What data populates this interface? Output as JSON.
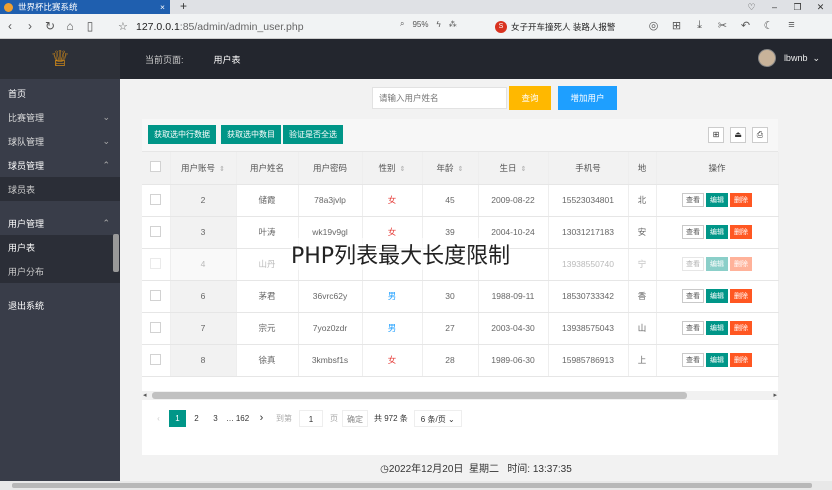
{
  "browser": {
    "tab_title": "世界杯比赛系统",
    "tab_close": "×",
    "new_tab": "+",
    "url_host": "127.0.0.1",
    "url_path": ":85/admin/admin_user.php",
    "zoom": "95%",
    "search_text": "女子开车撞死人 装路人报警",
    "window_controls": [
      "♡",
      "–",
      "❐",
      "✕"
    ]
  },
  "sidebar": {
    "logo_icon": "soccer-trophy-icon",
    "items": [
      {
        "label": "首页",
        "chev": ""
      },
      {
        "label": "比赛管理",
        "chev": "⌄"
      },
      {
        "label": "球队管理",
        "chev": "⌄"
      },
      {
        "label": "球员管理",
        "chev": "⌃"
      },
      {
        "label": "球员表",
        "chev": ""
      },
      {
        "label": "用户管理",
        "chev": "⌃"
      },
      {
        "label": "用户表",
        "chev": ""
      },
      {
        "label": "用户分布",
        "chev": ""
      },
      {
        "label": "退出系统",
        "chev": ""
      }
    ]
  },
  "header": {
    "crumb_label": "当前页面:",
    "crumb_current": "用户表",
    "username": "lbwnb",
    "user_chev": "⌄"
  },
  "search": {
    "placeholder": "请输入用户姓名",
    "query_label": "查询",
    "add_label": "增加用户"
  },
  "toolbar": {
    "btn_get_row": "获取选中行数据",
    "btn_get_count": "获取选中数目",
    "btn_check_all": "验证是否全选"
  },
  "table": {
    "headers": [
      "用户账号",
      "用户姓名",
      "用户密码",
      "性别",
      "年龄",
      "生日",
      "手机号",
      "地",
      "操作"
    ],
    "sort_glyph": "⇕",
    "rows": [
      {
        "id": "2",
        "name": "储霞",
        "pwd": "78a3jvlp",
        "gender": "女",
        "age": "45",
        "birthday": "2009-08-22",
        "phone": "15523034801",
        "addr": "北"
      },
      {
        "id": "3",
        "name": "叶涛",
        "pwd": "wk19v9gl",
        "gender": "女",
        "age": "39",
        "birthday": "2004-10-24",
        "phone": "13031217183",
        "addr": "安"
      },
      {
        "id": "4",
        "name": "山丹",
        "pwd": "",
        "gender": "",
        "age": "",
        "birthday": "",
        "phone": "13938550740",
        "addr": "宁"
      },
      {
        "id": "6",
        "name": "茅君",
        "pwd": "36vrc62y",
        "gender": "男",
        "age": "30",
        "birthday": "1988-09-11",
        "phone": "18530733342",
        "addr": "香"
      },
      {
        "id": "7",
        "name": "宗元",
        "pwd": "7yoz0zdr",
        "gender": "男",
        "age": "27",
        "birthday": "2003-04-30",
        "phone": "13938575043",
        "addr": "山"
      },
      {
        "id": "8",
        "name": "徐真",
        "pwd": "3kmbsf1s",
        "gender": "女",
        "age": "28",
        "birthday": "1989-06-30",
        "phone": "15985786913",
        "addr": "上"
      }
    ],
    "op_view": "查看",
    "op_edit": "编辑",
    "op_delete": "删除"
  },
  "pager": {
    "prev": "‹",
    "pages": [
      "1",
      "2",
      "3"
    ],
    "ellipsis": "…",
    "last": "162",
    "next": "›",
    "goto_label": "到第",
    "goto_value": "1",
    "page_unit": "页",
    "confirm": "确定",
    "total": "共 972 条",
    "page_size": "6 条/页",
    "size_chev": "⌄"
  },
  "overlay": {
    "title": "PHP列表最大长度限制"
  },
  "footer": {
    "clock_icon": "◷",
    "date": "2022年12月20日",
    "weekday": "星期二",
    "time_label": "时间:",
    "time": "13:37:35"
  }
}
